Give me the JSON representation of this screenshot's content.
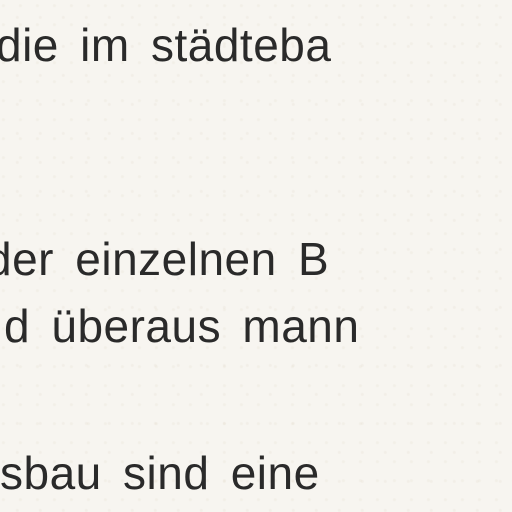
{
  "lines": [
    "die im städteba",
    "der einzelnen B",
    "d überaus mann",
    "sbau sind eine"
  ]
}
